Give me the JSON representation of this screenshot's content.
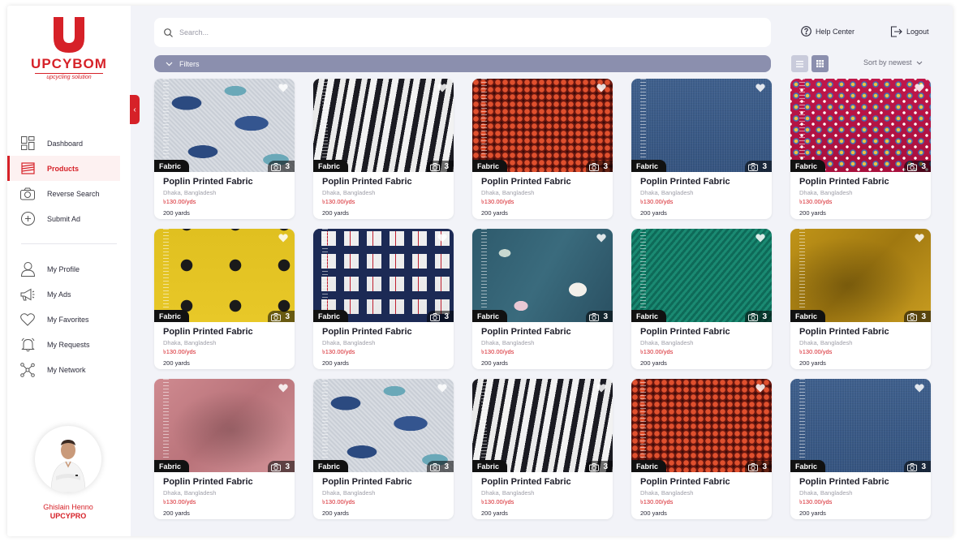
{
  "brand": {
    "name": "UPCYBOM",
    "tagline": "upcycling solution",
    "accent_color": "#d62128"
  },
  "sidebar": {
    "nav_primary": [
      {
        "label": "Dashboard",
        "icon": "dashboard-icon",
        "active": false
      },
      {
        "label": "Products",
        "icon": "products-icon",
        "active": true
      },
      {
        "label": "Reverse Search",
        "icon": "camera-icon",
        "active": false
      },
      {
        "label": "Submit Ad",
        "icon": "plus-circle-icon",
        "active": false
      }
    ],
    "nav_secondary": [
      {
        "label": "My Profile",
        "icon": "user-icon"
      },
      {
        "label": "My Ads",
        "icon": "megaphone-icon"
      },
      {
        "label": "My Favorites",
        "icon": "heart-icon"
      },
      {
        "label": "My Requests",
        "icon": "bell-icon"
      },
      {
        "label": "My Network",
        "icon": "network-icon"
      }
    ],
    "profile": {
      "name": "Ghislain Henno",
      "role": "UPCYPRO"
    }
  },
  "header": {
    "search_placeholder": "Search...",
    "help_label": "Help Center",
    "logout_label": "Logout"
  },
  "toolbar": {
    "filters_label": "Filters",
    "sort_label": "Sort by newest",
    "view_mode": "grid"
  },
  "products": [
    {
      "title": "Poplin Printed Fabric",
      "location": "Dhaka, Bangladesh",
      "price": "৳130.00/yds",
      "quantity": "200 yards",
      "category": "Fabric",
      "photos": "3",
      "pattern": "whale"
    },
    {
      "title": "Poplin Printed Fabric",
      "location": "Dhaka, Bangladesh",
      "price": "৳130.00/yds",
      "quantity": "200 yards",
      "category": "Fabric",
      "photos": "3",
      "pattern": "zebra"
    },
    {
      "title": "Poplin Printed Fabric",
      "location": "Dhaka, Bangladesh",
      "price": "৳130.00/yds",
      "quantity": "200 yards",
      "category": "Fabric",
      "photos": "3",
      "pattern": "sequin"
    },
    {
      "title": "Poplin Printed Fabric",
      "location": "Dhaka, Bangladesh",
      "price": "৳130.00/yds",
      "quantity": "200 yards",
      "category": "Fabric",
      "photos": "3",
      "pattern": "denim"
    },
    {
      "title": "Poplin Printed Fabric",
      "location": "Dhaka, Bangladesh",
      "price": "৳130.00/yds",
      "quantity": "200 yards",
      "category": "Fabric",
      "photos": "3",
      "pattern": "floral-pink"
    },
    {
      "title": "Poplin Printed Fabric",
      "location": "Dhaka, Bangladesh",
      "price": "৳130.00/yds",
      "quantity": "200 yards",
      "category": "Fabric",
      "photos": "3",
      "pattern": "polka-yellow"
    },
    {
      "title": "Poplin Printed Fabric",
      "location": "Dhaka, Bangladesh",
      "price": "৳130.00/yds",
      "quantity": "200 yards",
      "category": "Fabric",
      "photos": "3",
      "pattern": "plaid"
    },
    {
      "title": "Poplin Printed Fabric",
      "location": "Dhaka, Bangladesh",
      "price": "৳130.00/yds",
      "quantity": "200 yards",
      "category": "Fabric",
      "photos": "3",
      "pattern": "dragonfly"
    },
    {
      "title": "Poplin Printed Fabric",
      "location": "Dhaka, Bangladesh",
      "price": "৳130.00/yds",
      "quantity": "200 yards",
      "category": "Fabric",
      "photos": "3",
      "pattern": "teal-pleat"
    },
    {
      "title": "Poplin Printed Fabric",
      "location": "Dhaka, Bangladesh",
      "price": "৳130.00/yds",
      "quantity": "200 yards",
      "category": "Fabric",
      "photos": "3",
      "pattern": "mustard"
    },
    {
      "title": "Poplin Printed Fabric",
      "location": "Dhaka, Bangladesh",
      "price": "৳130.00/yds",
      "quantity": "200 yards",
      "category": "Fabric",
      "photos": "3",
      "pattern": "pink-linen"
    },
    {
      "title": "Poplin Printed Fabric",
      "location": "Dhaka, Bangladesh",
      "price": "৳130.00/yds",
      "quantity": "200 yards",
      "category": "Fabric",
      "photos": "3",
      "pattern": "whale"
    },
    {
      "title": "Poplin Printed Fabric",
      "location": "Dhaka, Bangladesh",
      "price": "৳130.00/yds",
      "quantity": "200 yards",
      "category": "Fabric",
      "photos": "3",
      "pattern": "zebra"
    },
    {
      "title": "Poplin Printed Fabric",
      "location": "Dhaka, Bangladesh",
      "price": "৳130.00/yds",
      "quantity": "200 yards",
      "category": "Fabric",
      "photos": "3",
      "pattern": "sequin"
    },
    {
      "title": "Poplin Printed Fabric",
      "location": "Dhaka, Bangladesh",
      "price": "৳130.00/yds",
      "quantity": "200 yards",
      "category": "Fabric",
      "photos": "3",
      "pattern": "denim"
    }
  ]
}
